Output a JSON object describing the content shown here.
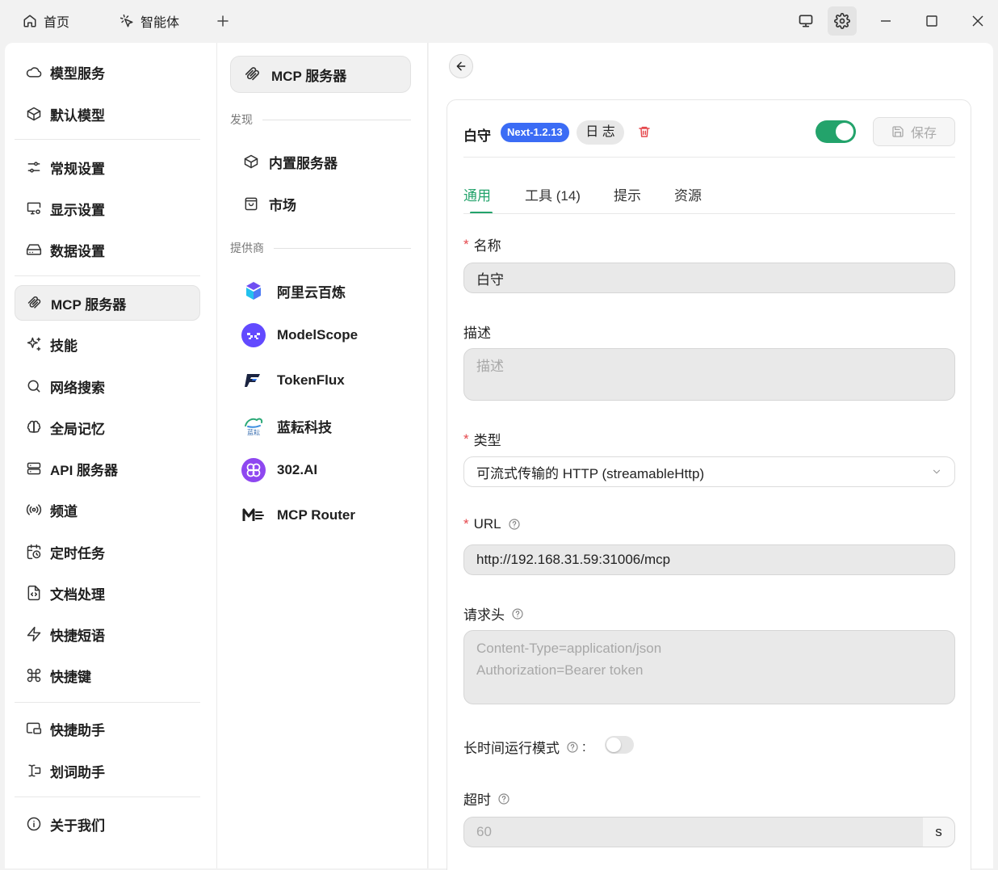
{
  "titlebar": {
    "tabs": [
      {
        "label": "首页",
        "icon": "home-icon"
      },
      {
        "label": "智能体",
        "icon": "sparkle-cursor-icon"
      }
    ],
    "controls": [
      "monitor-icon",
      "gear-icon",
      "minimize-icon",
      "maximize-icon",
      "close-icon"
    ]
  },
  "sidebar": {
    "items": [
      {
        "label": "模型服务",
        "icon": "cloud-icon"
      },
      {
        "label": "默认模型",
        "icon": "cube-icon"
      },
      {
        "label": "常规设置",
        "icon": "sliders-icon"
      },
      {
        "label": "显示设置",
        "icon": "monitor-gear-icon"
      },
      {
        "label": "数据设置",
        "icon": "drive-icon"
      },
      {
        "label": "MCP 服务器",
        "icon": "mcp-icon",
        "active": true
      },
      {
        "label": "技能",
        "icon": "sparkles-icon"
      },
      {
        "label": "网络搜索",
        "icon": "search-icon"
      },
      {
        "label": "全局记忆",
        "icon": "brain-icon"
      },
      {
        "label": "API 服务器",
        "icon": "server-icon"
      },
      {
        "label": "频道",
        "icon": "radio-icon"
      },
      {
        "label": "定时任务",
        "icon": "calendar-clock-icon"
      },
      {
        "label": "文档处理",
        "icon": "file-code-icon"
      },
      {
        "label": "快捷短语",
        "icon": "zap-icon"
      },
      {
        "label": "快捷键",
        "icon": "command-icon"
      },
      {
        "label": "快捷助手",
        "icon": "app-window-icon"
      },
      {
        "label": "划词助手",
        "icon": "text-cursor-icon"
      },
      {
        "label": "关于我们",
        "icon": "info-icon"
      }
    ]
  },
  "middle": {
    "header": "MCP 服务器",
    "discover_label": "发现",
    "discover_items": [
      {
        "label": "内置服务器",
        "icon": "cube-icon"
      },
      {
        "label": "市场",
        "icon": "shopping-bag-icon"
      }
    ],
    "providers_label": "提供商",
    "providers": [
      {
        "label": "阿里云百炼",
        "icon": "bailian-logo-icon"
      },
      {
        "label": "ModelScope",
        "icon": "modelscope-logo-icon"
      },
      {
        "label": "TokenFlux",
        "icon": "tokenflux-logo-icon"
      },
      {
        "label": "蓝耘科技",
        "icon": "lanyun-logo-icon"
      },
      {
        "label": "302.AI",
        "icon": "302ai-logo-icon"
      },
      {
        "label": "MCP Router",
        "icon": "mcprouter-logo-icon"
      }
    ],
    "lanyun_logo_text": "蓝耘"
  },
  "detail": {
    "server_name": "白守",
    "version_badge": "Next-1.2.13",
    "log_button": "日 志",
    "save_button": "保存",
    "enabled": true,
    "tabs": [
      "通用",
      "工具 (14)",
      "提示",
      "资源"
    ],
    "active_tab": 0,
    "fields": {
      "name_label": "名称",
      "name_value": "白守",
      "desc_label": "描述",
      "desc_placeholder": "描述",
      "type_label": "类型",
      "type_value": "可流式传输的 HTTP (streamableHttp)",
      "url_label": "URL",
      "url_value": "http://192.168.31.59:31006/mcp",
      "headers_label": "请求头",
      "headers_placeholder_1": "Content-Type=application/json",
      "headers_placeholder_2": "Authorization=Bearer token",
      "longrun_label": "长时间运行模式",
      "longrun_colon": ":",
      "longrun_enabled": false,
      "timeout_label": "超时",
      "timeout_placeholder": "60",
      "timeout_unit": "s"
    }
  },
  "colors": {
    "accent": "#23a36b",
    "badge": "#3b6cf5",
    "danger": "#e5484d"
  }
}
